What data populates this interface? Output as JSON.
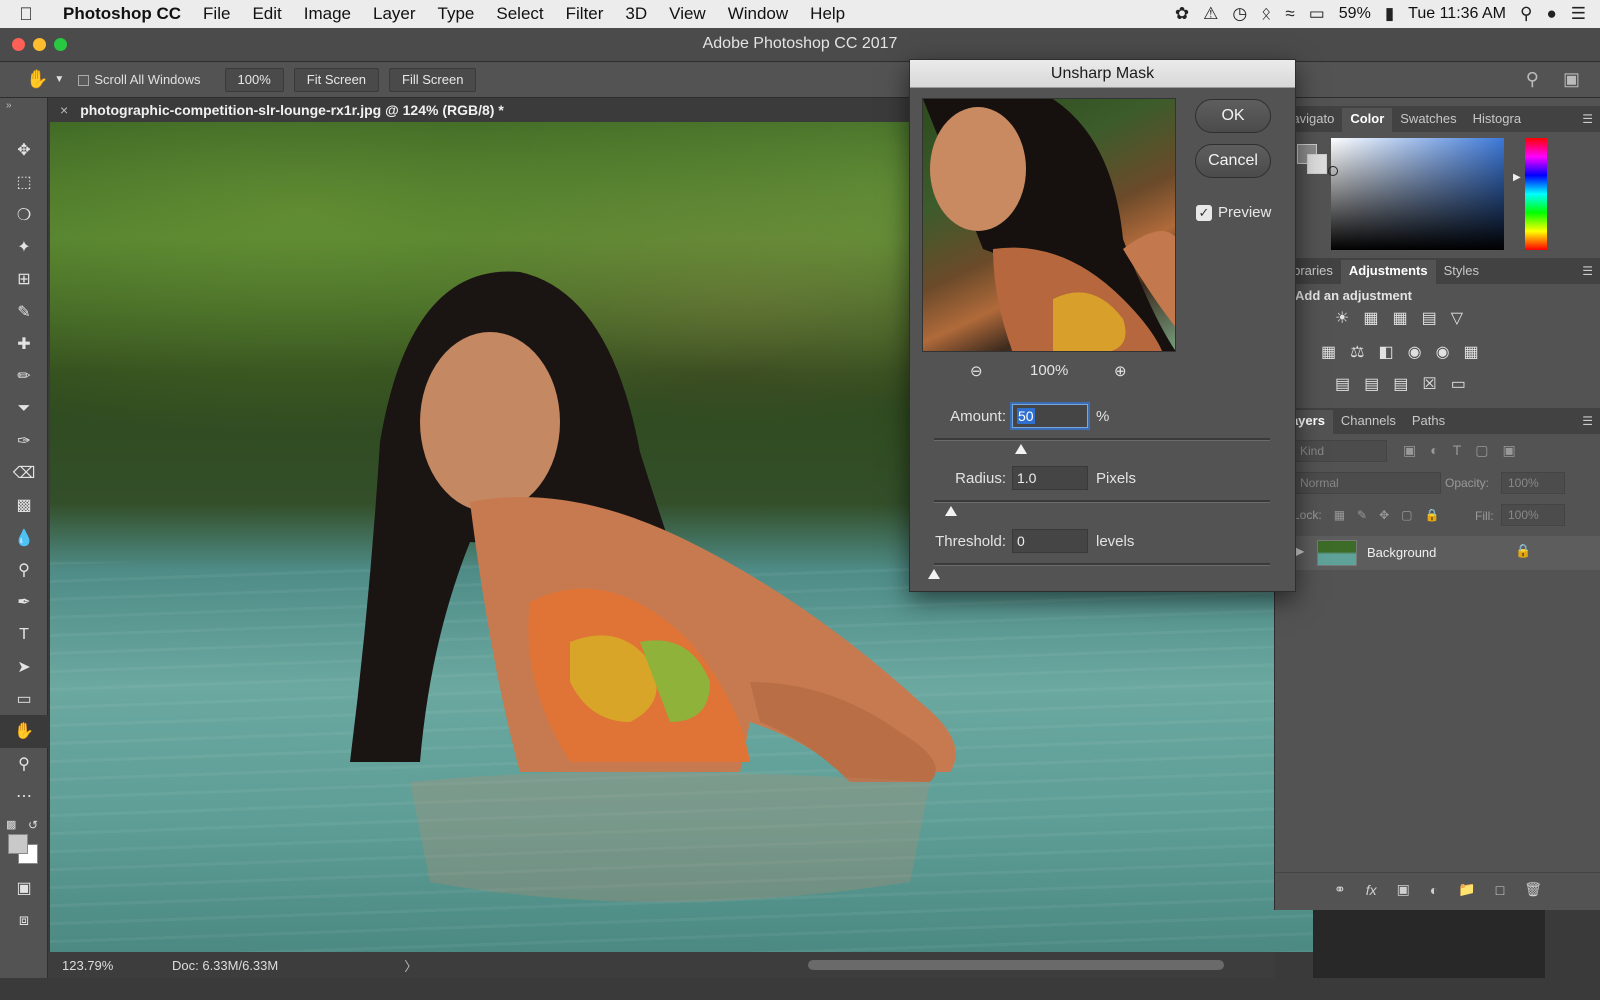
{
  "menubar": {
    "app_name": "Photoshop CC",
    "menus": [
      "File",
      "Edit",
      "Image",
      "Layer",
      "Type",
      "Select",
      "Filter",
      "3D",
      "View",
      "Window",
      "Help"
    ],
    "battery": "59%",
    "clock": "Tue 11:36 AM"
  },
  "window": {
    "title": "Adobe Photoshop CC 2017"
  },
  "options_bar": {
    "scroll_all_windows": "Scroll All Windows",
    "zoom_100": "100%",
    "fit_screen": "Fit Screen",
    "fill_screen": "Fill Screen"
  },
  "document": {
    "tab_title": "photographic-competition-slr-lounge-rx1r.jpg @ 124% (RGB/8) *"
  },
  "status": {
    "zoom": "123.79%",
    "doc_size": "Doc: 6.33M/6.33M"
  },
  "panels": {
    "top_tabs": [
      "Navigato",
      "Color",
      "Swatches",
      "Histogra"
    ],
    "mid_tabs": [
      "Libraries",
      "Adjustments",
      "Styles"
    ],
    "adjust_hint": "Add an adjustment",
    "layer_tabs": [
      "Layers",
      "Channels",
      "Paths"
    ],
    "kind_placeholder": "Kind",
    "blend_mode": "Normal",
    "opacity_label": "Opacity:",
    "opacity_value": "100%",
    "lock_label": "Lock:",
    "fill_label": "Fill:",
    "fill_value": "100%",
    "layer_name": "Background"
  },
  "dialog": {
    "title": "Unsharp Mask",
    "ok": "OK",
    "cancel": "Cancel",
    "preview_label": "Preview",
    "preview_checked": true,
    "preview_zoom": "100%",
    "amount_label": "Amount:",
    "amount_value": "50",
    "amount_unit": "%",
    "radius_label": "Radius:",
    "radius_value": "1.0",
    "radius_unit": "Pixels",
    "threshold_label": "Threshold:",
    "threshold_value": "0",
    "threshold_unit": "levels",
    "amount_slider_fraction": 0.26,
    "radius_slider_fraction": 0.05,
    "threshold_slider_fraction": 0.0
  },
  "colors": {
    "traffic_close": "#fe5f57",
    "traffic_min": "#febc2e",
    "traffic_max": "#28c840",
    "accent_selection": "#2f6fd0"
  }
}
